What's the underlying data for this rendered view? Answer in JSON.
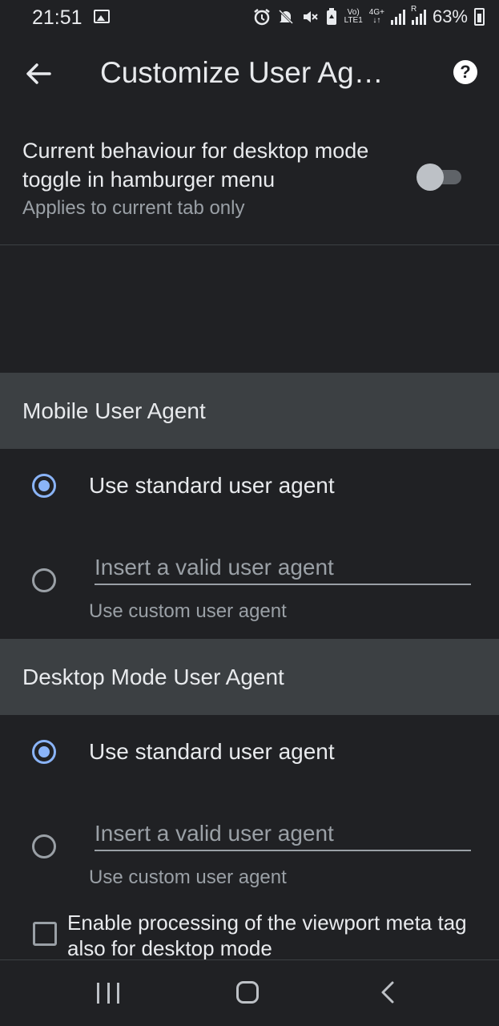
{
  "status_bar": {
    "time": "21:51",
    "icons": [
      "image-icon",
      "alarm-icon",
      "mute-icon",
      "no-sound-icon",
      "battery-saver-icon",
      "volte-icon",
      "4g-icon",
      "signal-icon",
      "signal-roaming-icon",
      "battery-icon"
    ],
    "volte_top": "Vo)",
    "volte_bottom": "LTE1",
    "net_top": "4G+",
    "net_bottom": "↓↑",
    "roaming": "R",
    "battery": "63%"
  },
  "app_bar": {
    "title": "Customize User Ag…",
    "back_icon": "arrow-back-icon",
    "help_icon": "help-icon",
    "help_glyph": "?"
  },
  "desktop_toggle": {
    "title": "Current behaviour for desktop mode toggle in hamburger menu",
    "summary": "Applies to current tab only",
    "enabled": false
  },
  "mobile_section": {
    "header": "Mobile User Agent",
    "standard_label": "Use standard user agent",
    "standard_checked": true,
    "custom_placeholder": "Insert a valid user agent",
    "custom_value": "",
    "custom_label": "Use custom user agent",
    "custom_checked": false
  },
  "desktop_section": {
    "header": "Desktop Mode User Agent",
    "standard_label": "Use standard user agent",
    "standard_checked": true,
    "custom_placeholder": "Insert a valid user agent",
    "custom_value": "",
    "custom_label": "Use custom user agent",
    "custom_checked": false
  },
  "viewport_checkbox": {
    "label": "Enable processing of the viewport meta tag also for desktop mode",
    "checked": false
  },
  "nav_bar": {
    "buttons": [
      "recent-apps",
      "home",
      "back"
    ]
  },
  "colors": {
    "background": "#202124",
    "section_header": "#3c4043",
    "accent": "#8ab4f8",
    "text_primary": "#e8eaed",
    "text_secondary": "#9aa0a6"
  }
}
